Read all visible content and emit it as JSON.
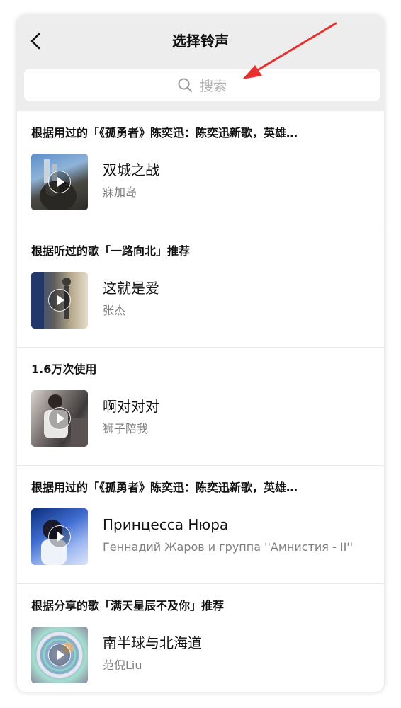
{
  "header": {
    "title": "选择铃声"
  },
  "search": {
    "placeholder": "搜索"
  },
  "sections": [
    {
      "reason": "根据用过的「《孤勇者》陈奕迅：陈奕迅新歌，英雄…",
      "song": {
        "title": "双城之战",
        "artist": "寐加岛"
      }
    },
    {
      "reason": "根据听过的歌「一路向北」推荐",
      "song": {
        "title": "这就是爱",
        "artist": "张杰"
      }
    },
    {
      "reason": "1.6万次使用",
      "song": {
        "title": "啊对对对",
        "artist": "狮子陪我"
      }
    },
    {
      "reason": "根据用过的「《孤勇者》陈奕迅：陈奕迅新歌，英雄…",
      "song": {
        "title": "Принцесса Нюра",
        "artist": "Геннадий Жаров и группа ''Амнистия - II''"
      }
    },
    {
      "reason": "根据分享的歌「满天星辰不及你」推荐",
      "song": {
        "title": "南半球与北海道",
        "artist": "范倪Liu"
      }
    }
  ],
  "colors": {
    "header_bg": "#ededed",
    "annotation_arrow": "#e8312f",
    "secondary_text": "#7f7f7f"
  },
  "icons": {
    "back": "chevron-left-icon",
    "search": "search-icon",
    "play": "play-icon"
  }
}
